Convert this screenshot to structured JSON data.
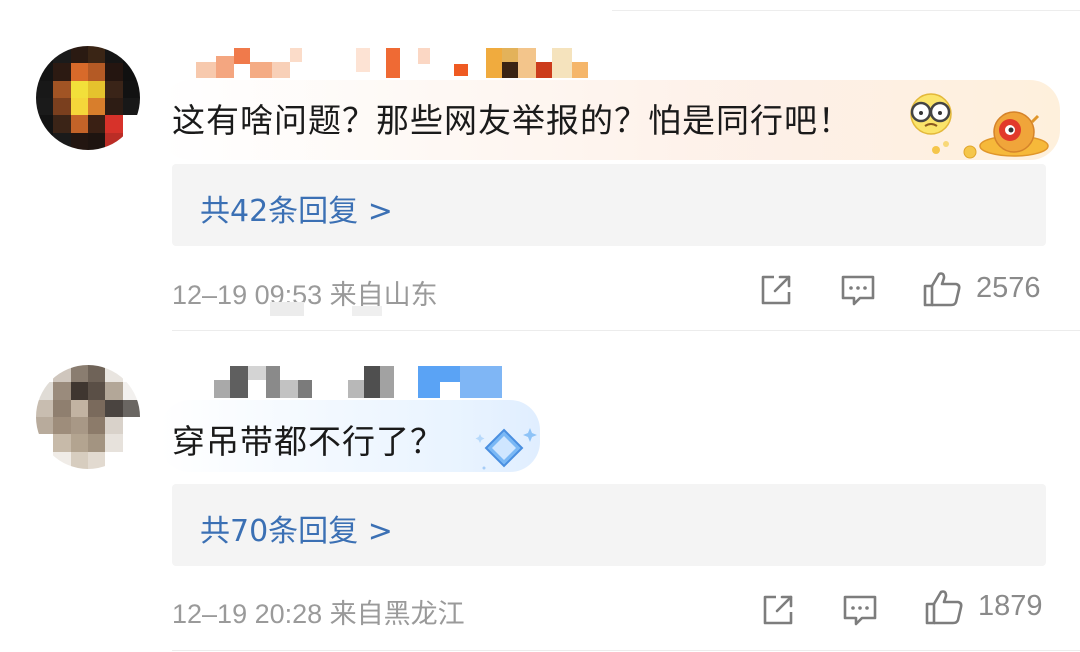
{
  "comments": [
    {
      "text": "这有啥问题？那些网友举报的？怕是同行吧！",
      "replies_label": "共42条回复 >",
      "meta": "12–19 09:53 来自山东",
      "like_count": "2576",
      "badge_icon": "gold-ufo-badge-icon",
      "emoji_icon": "glasses-face-emoji-icon"
    },
    {
      "text": "穿吊带都不行了？",
      "replies_label": "共70条回复 >",
      "meta": "12–19 20:28 来自黑龙江",
      "like_count": "1879",
      "badge_icon": "blue-diamond-badge-icon"
    }
  ],
  "colors": {
    "link_blue": "#3b70b4",
    "meta_grey": "#9a9a9a",
    "reply_box_bg": "#f4f4f4",
    "text": "#1a1a1a"
  },
  "icons": {
    "share": "share-icon",
    "comment": "comment-icon",
    "like": "thumbs-up-icon"
  }
}
